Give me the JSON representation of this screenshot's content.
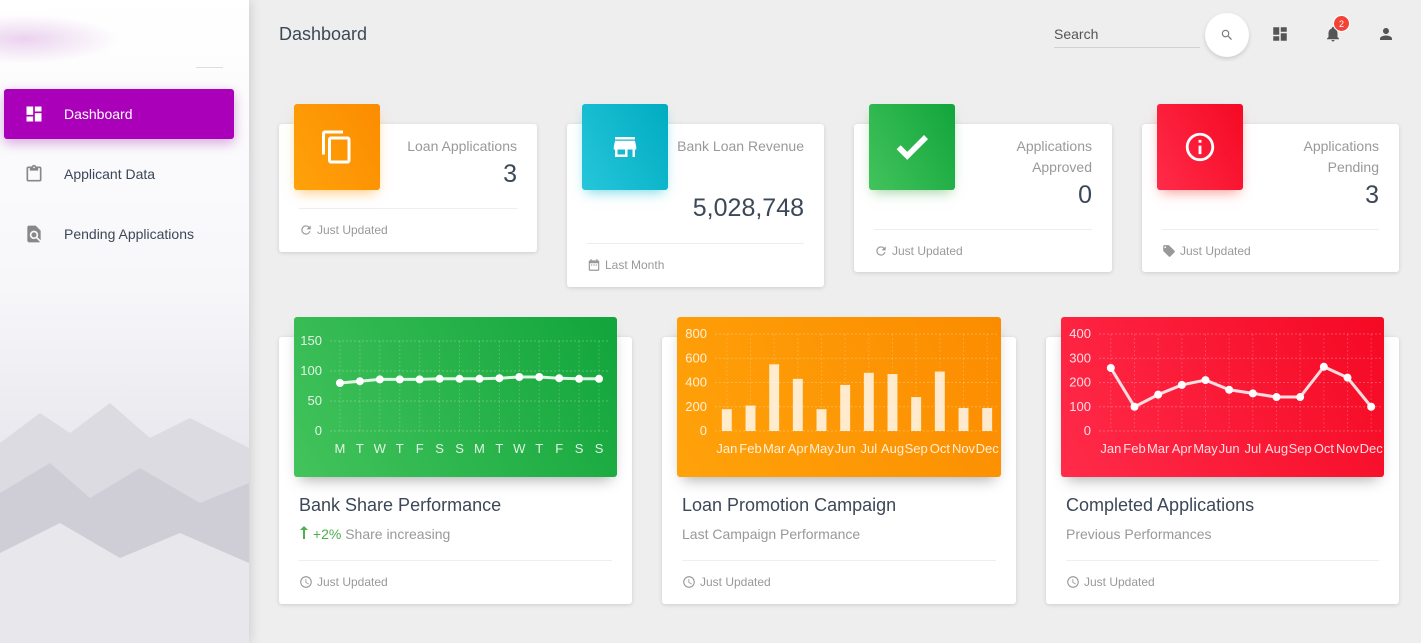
{
  "sidebar": {
    "items": [
      {
        "label": "Dashboard",
        "icon": "dashboard-icon",
        "active": true
      },
      {
        "label": "Applicant Data",
        "icon": "clipboard-icon",
        "active": false
      },
      {
        "label": "Pending Applications",
        "icon": "find-in-page-icon",
        "active": false
      }
    ]
  },
  "header": {
    "title": "Dashboard",
    "search_placeholder": "Search",
    "notification_count": "2"
  },
  "stats": [
    {
      "title": "Loan Applications",
      "value": "3",
      "footer": "Just Updated",
      "icon": "copy-icon",
      "footer_icon": "refresh-icon",
      "color": "#ff9800"
    },
    {
      "title": "Bank Loan Revenue",
      "value": "5,028,748",
      "footer": "Last Month",
      "icon": "store-icon",
      "footer_icon": "calendar-icon",
      "color": "#00bcd4"
    },
    {
      "title_line1": "Applications",
      "title_line2": "Approved",
      "value": "0",
      "footer": "Just Updated",
      "icon": "check-icon",
      "footer_icon": "refresh-icon",
      "color": "#4caf50"
    },
    {
      "title_line1": "Applications",
      "title_line2": "Pending",
      "value": "3",
      "footer": "Just Updated",
      "icon": "info-icon",
      "footer_icon": "tag-icon",
      "color": "#f44336"
    }
  ],
  "charts": [
    {
      "title": "Bank Share Performance",
      "change": "+2%",
      "subtitle": "Share increasing",
      "footer": "Just Updated",
      "color": "#4caf50"
    },
    {
      "title": "Loan Promotion Campaign",
      "subtitle": "Last Campaign Performance",
      "footer": "Just Updated",
      "color": "#ff9800"
    },
    {
      "title": "Completed Applications",
      "subtitle": "Previous Performances",
      "footer": "Just Updated",
      "color": "#f44336"
    }
  ],
  "chart_data": [
    {
      "type": "line",
      "categories": [
        "M",
        "T",
        "W",
        "T",
        "F",
        "S",
        "S",
        "M",
        "T",
        "W",
        "T",
        "F",
        "S",
        "S"
      ],
      "values": [
        80,
        83,
        86,
        86,
        86,
        87,
        87,
        87,
        88,
        90,
        90,
        88,
        87,
        87
      ],
      "title": "Bank Share Performance",
      "ylim": [
        0,
        150
      ],
      "yticks": [
        0,
        50,
        100,
        150
      ],
      "grid": true
    },
    {
      "type": "bar",
      "categories": [
        "Jan",
        "Feb",
        "Mar",
        "Apr",
        "May",
        "Jun",
        "Jul",
        "Aug",
        "Sep",
        "Oct",
        "Nov",
        "Dec"
      ],
      "values": [
        180,
        210,
        550,
        430,
        180,
        380,
        480,
        470,
        280,
        490,
        190,
        190
      ],
      "title": "Loan Promotion Campaign",
      "ylim": [
        0,
        800
      ],
      "yticks": [
        0,
        200,
        400,
        600,
        800
      ],
      "grid": true
    },
    {
      "type": "line",
      "categories": [
        "Jan",
        "Feb",
        "Mar",
        "Apr",
        "May",
        "Jun",
        "Jul",
        "Aug",
        "Sep",
        "Oct",
        "Nov",
        "Dec"
      ],
      "values": [
        260,
        100,
        150,
        190,
        210,
        170,
        155,
        140,
        140,
        265,
        220,
        100
      ],
      "title": "Completed Applications",
      "ylim": [
        0,
        400
      ],
      "yticks": [
        0,
        100,
        200,
        300,
        400
      ],
      "grid": true
    }
  ]
}
